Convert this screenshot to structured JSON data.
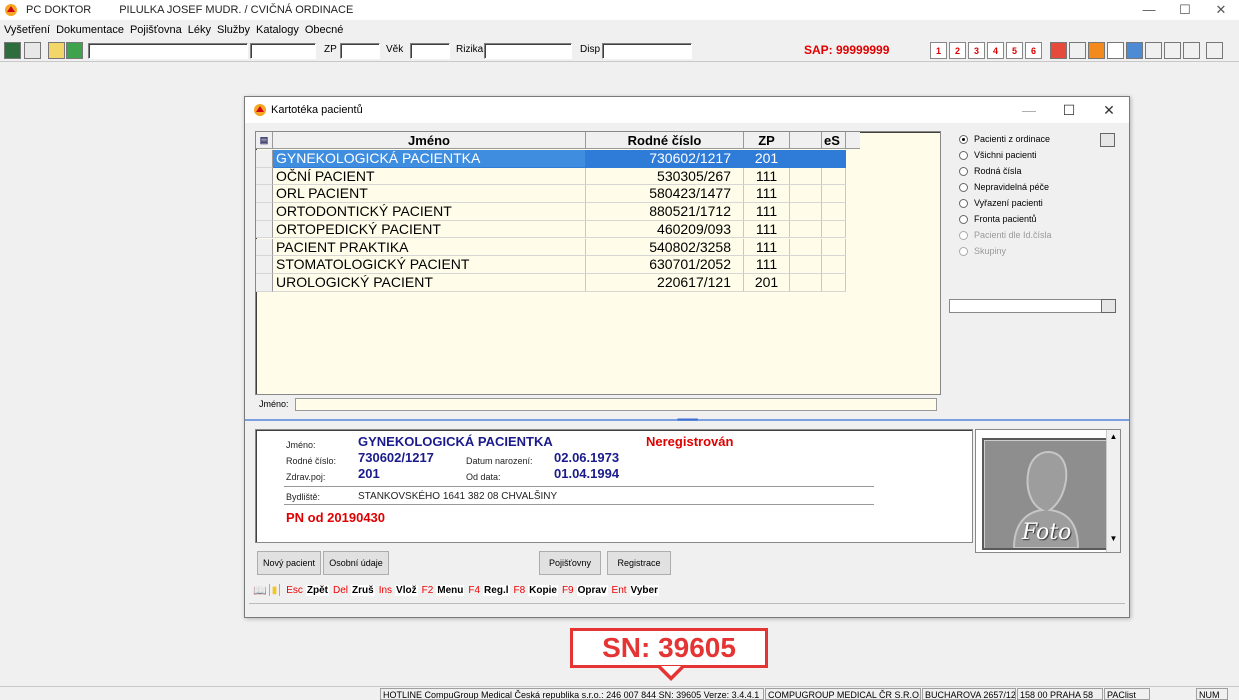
{
  "window": {
    "app_name": "PC DOKTOR",
    "title": "PILULKA JOSEF MUDR. / CVIČNÁ ORDINACE",
    "minimize": "—",
    "maximize": "☐",
    "close": "✕"
  },
  "menu": [
    "Vyšetření",
    "Dokumentace",
    "Pojišťovna",
    "Léky",
    "Služby",
    "Katalogy",
    "Obecné"
  ],
  "toolbar": {
    "zp_label": "ZP",
    "vek_label": "Věk",
    "rizika_label": "Rizika",
    "disp_label": "Disp",
    "sap": "SAP: 99999999",
    "rx_buttons": [
      "1",
      "2",
      "3",
      "4",
      "5",
      "6"
    ]
  },
  "dialog": {
    "title": "Kartotéka pacientů",
    "minimize": "—",
    "maximize": "☐",
    "close": "✕",
    "grid": {
      "columns": [
        "Jméno",
        "Rodné číslo",
        "ZP",
        "",
        "eS"
      ],
      "rows": [
        {
          "name": "GYNEKOLOGICKÁ PACIENTKA",
          "rc": "730602/1217",
          "zp": "201"
        },
        {
          "name": "OČNÍ PACIENT",
          "rc": "530305/267",
          "zp": "111"
        },
        {
          "name": "ORL PACIENT",
          "rc": "580423/1477",
          "zp": "111"
        },
        {
          "name": "ORTODONTICKÝ PACIENT",
          "rc": "880521/1712",
          "zp": "111"
        },
        {
          "name": "ORTOPEDICKÝ PACIENT",
          "rc": "460209/093",
          "zp": "111"
        },
        {
          "name": "PACIENT PRAKTIKA",
          "rc": "540802/3258",
          "zp": "111"
        },
        {
          "name": "STOMATOLOGICKÝ PACIENT",
          "rc": "630701/2052",
          "zp": "111"
        },
        {
          "name": "UROLOGICKÝ PACIENT",
          "rc": "220617/121",
          "zp": "201"
        }
      ],
      "selected_index": 0
    },
    "name_filter_label": "Jméno:",
    "radios": [
      {
        "label": "Pacienti z ordinace",
        "checked": true,
        "disabled": false
      },
      {
        "label": "Všichni pacienti",
        "checked": false,
        "disabled": false
      },
      {
        "label": "Rodná čísla",
        "checked": false,
        "disabled": false
      },
      {
        "label": "Nepravidelná péče",
        "checked": false,
        "disabled": false
      },
      {
        "label": "Vyřazení pacienti",
        "checked": false,
        "disabled": false
      },
      {
        "label": "Fronta pacientů",
        "checked": false,
        "disabled": false
      },
      {
        "label": "Pacienti dle Id.čísla",
        "checked": false,
        "disabled": true
      },
      {
        "label": "Skupiny",
        "checked": false,
        "disabled": true
      }
    ],
    "detail": {
      "jmeno_label": "Jméno:",
      "jmeno": "GYNEKOLOGICKÁ PACIENTKA",
      "status": "Neregistrován",
      "rc_label": "Rodné číslo:",
      "rc": "730602/1217",
      "dn_label": "Datum narození:",
      "dn": "02.06.1973",
      "zp_label": "Zdrav.poj:",
      "zp": "201",
      "od_label": "Od data:",
      "od": "01.04.1994",
      "bydliste_label": "Bydliště:",
      "bydliste": "STANKOVSKÉHO 1641  382 08 CHVALŠINY",
      "pn": "PN od 20190430",
      "photo_label": "Foto"
    },
    "buttons": {
      "novy": "Nový pacient",
      "osobni": "Osobní údaje",
      "pojistovny": "Pojišťovny",
      "registrace": "Registrace"
    },
    "keys": [
      {
        "key": "Esc",
        "action": "Zpět"
      },
      {
        "key": "Del",
        "action": "Zruš"
      },
      {
        "key": "Ins",
        "action": "Vlož"
      },
      {
        "key": "F2",
        "action": "Menu"
      },
      {
        "key": "F4",
        "action": "Reg.l"
      },
      {
        "key": "F8",
        "action": "Kopie"
      },
      {
        "key": "F9",
        "action": "Oprav"
      },
      {
        "key": "Ent",
        "action": "Vyber"
      }
    ]
  },
  "callout": "SN: 39605",
  "statusbar": {
    "hotline": "HOTLINE CompuGroup Medical Česká republika s.r.o.: 246 007 844 SN: 39605 Verze: 3.4.4.1",
    "company": "COMPUGROUP MEDICAL ČR S.R.O.",
    "street": "BUCHAROVA 2657/12",
    "city": "158 00 PRAHA 58",
    "paclist": "PAClist",
    "num": "NUM"
  },
  "colors": {
    "selection": "#2f7bd8",
    "grid_bg": "#fffde9",
    "detail_value": "#1a1a8c",
    "alert_red": "#e00000"
  }
}
